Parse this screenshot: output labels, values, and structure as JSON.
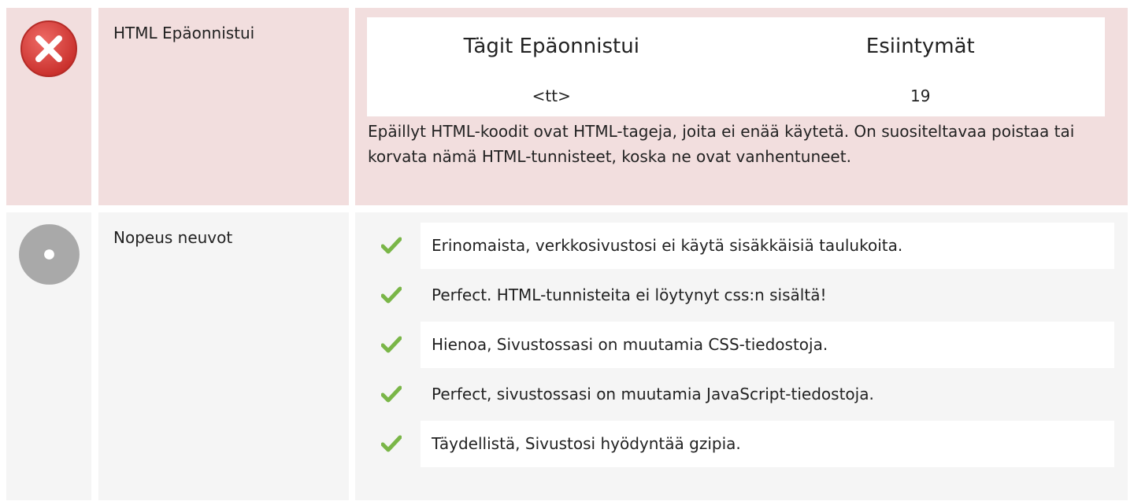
{
  "colors": {
    "fail_bg": "#f2dede",
    "neutral_bg": "#f5f5f5",
    "fail_icon": "#d9534f",
    "neutral_icon": "#a9a9a9",
    "check": "#7ab648"
  },
  "html_check": {
    "status_icon": "error-x-icon",
    "label": "HTML Epäonnistui",
    "table": {
      "headers": [
        "Tägit Epäonnistui",
        "Esiintymät"
      ],
      "rows": [
        {
          "tag": "<tt>",
          "count": "19"
        }
      ]
    },
    "description": "Epäillyt HTML-koodit ovat HTML-tageja, joita ei enää käytetä. On suositeltavaa poistaa tai korvata nämä HTML-tunnisteet, koska ne ovat vanhentuneet."
  },
  "speed_tips": {
    "status_icon": "neutral-circle-icon",
    "label": "Nopeus neuvot",
    "items": [
      {
        "icon": "check-icon",
        "text": "Erinomaista, verkkosivustosi ei käytä sisäkkäisiä taulukoita."
      },
      {
        "icon": "check-icon",
        "text": "Perfect. HTML-tunnisteita ei löytynyt css:n sisältä!"
      },
      {
        "icon": "check-icon",
        "text": "Hienoa, Sivustossasi on muutamia CSS-tiedostoja."
      },
      {
        "icon": "check-icon",
        "text": "Perfect, sivustossasi on muutamia JavaScript-tiedostoja."
      },
      {
        "icon": "check-icon",
        "text": "Täydellistä, Sivustosi hyödyntää gzipia."
      }
    ]
  }
}
